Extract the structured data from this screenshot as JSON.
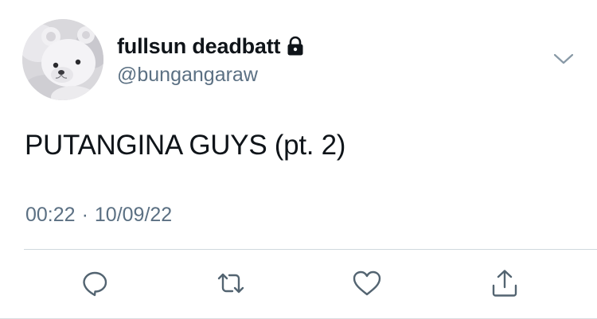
{
  "tweet": {
    "display_name": "fullsun deadbatt",
    "handle": "@bungangaraw",
    "text": "PUTANGINA GUYS (pt. 2)",
    "time": "00:22",
    "separator": "·",
    "date": "10/09/22",
    "protected": true
  },
  "icons": {
    "lock": "lock-icon",
    "more": "chevron-down-icon",
    "reply": "reply-icon",
    "retweet": "retweet-icon",
    "like": "heart-icon",
    "share": "share-icon"
  },
  "colors": {
    "text": "#0f1419",
    "secondary": "#5b7083",
    "divider": "#cfd9de",
    "icon": "#536471"
  }
}
